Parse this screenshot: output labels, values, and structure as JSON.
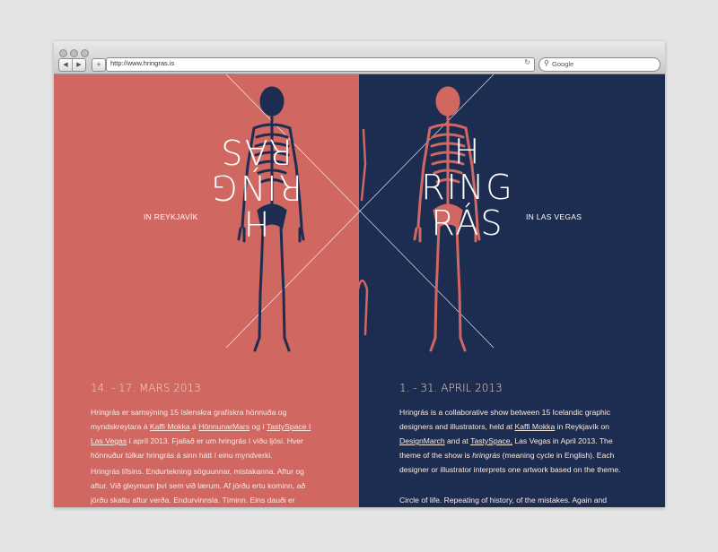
{
  "browser": {
    "url": "http://www.hringras.is",
    "search_placeholder": "Google",
    "back_icon": "back-arrow-icon",
    "forward_icon": "forward-arrow-icon"
  },
  "left": {
    "city": "IN REYKJAVÍK",
    "logo_line1": "H",
    "logo_line2": "RING",
    "logo_line3": "RÁS",
    "date": "14. - 17. MARS 2013",
    "p1": {
      "t1": "Hringrás er samsýning 15 íslenskra grafískra hönnuða og myndskreytara á ",
      "link1": "Kaffi Mokka",
      "t2": " á ",
      "link2": "HönnunarMars",
      "t3": " og í ",
      "link3": "TastySpace í Las Vegas",
      "t4": " í apríl 2013. Fjallað er um hringrás í víðu ljósi. Hver hönnuður túlkar hringrás á sinn hátt í einu myndverki."
    },
    "p2": "Hringrás lífsins. Endurtekning söguunnar, mistakanna. Aftur og aftur. Við gleymum því sem við lærum. Af jörðu ertu kominn, að jörðu skaltu aftur verða. Endurvinnsla. Tíminn. Eins dauði er"
  },
  "right": {
    "city": "IN LAS VEGAS",
    "logo_line1": "H",
    "logo_line2": "RING",
    "logo_line3": "RÁS",
    "date": "1. - 31. APRIL 2013",
    "p1": {
      "t1": "Hringrás is a collaborative show between 15 Icelandic graphic designers and illustrators, held at ",
      "link1": "Kaffi Mokka",
      "t2": " in Reykjavík on ",
      "link2": "DesignMarch",
      "t3": " and at ",
      "link3": "TastySpace,",
      "t4": " Las Vegas in April 2013. The theme of the show is ",
      "em1": "hringrás",
      "t5": " (meaning cycle in English). Each designer or illustrator interprets one artwork based on the theme."
    },
    "p2": "Circle of life. Repeating of history, of the mistakes. Again and"
  },
  "colors": {
    "left_bg": "#d06760",
    "right_bg": "#1d2d51",
    "left_skeleton": "#1d2d51",
    "right_skeleton": "#d06760"
  }
}
